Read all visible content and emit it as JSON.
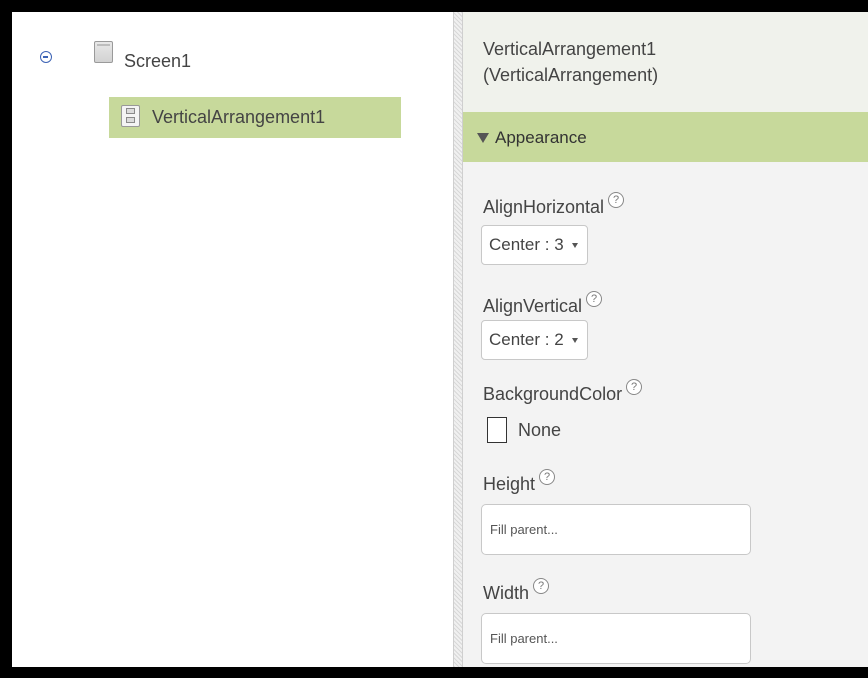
{
  "tree": {
    "screen_label": "Screen1",
    "selected_label": "VerticalArrangement1"
  },
  "properties": {
    "title": "VerticalArrangement1\n(VerticalArrangement)",
    "section_label": "Appearance",
    "help_glyph": "?",
    "align_horizontal": {
      "label": "AlignHorizontal",
      "value": "Center : 3"
    },
    "align_vertical": {
      "label": "AlignVertical",
      "value": "Center : 2"
    },
    "background_color": {
      "label": "BackgroundColor",
      "value": "None"
    },
    "height": {
      "label": "Height",
      "placeholder": "Fill parent..."
    },
    "width": {
      "label": "Width",
      "placeholder": "Fill parent..."
    }
  },
  "colors": {
    "selection": "#c7d99b",
    "section_bar": "#c7d99b",
    "panel_bg": "#f3f3f3",
    "toggle_blue": "#3d63b5"
  },
  "icons": {
    "collapse": "collapse-minus-icon",
    "screen": "screen-icon",
    "vertical_arrangement": "vertical-arrangement-icon",
    "section_toggle": "triangle-down-icon",
    "help": "help-question-icon",
    "dropdown": "caret-down-icon",
    "color_swatch": "color-swatch-icon"
  }
}
